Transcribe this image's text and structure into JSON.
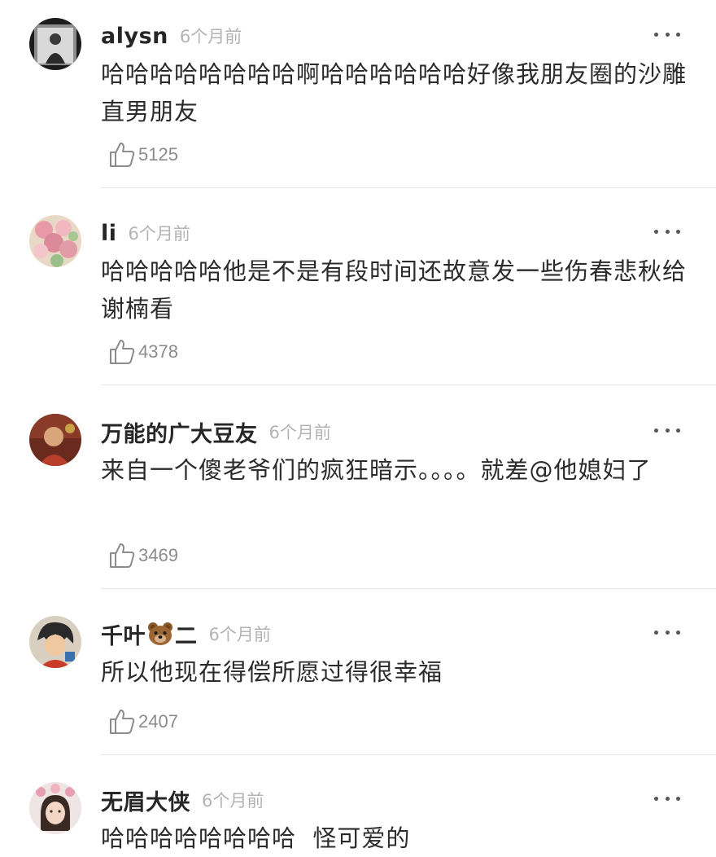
{
  "comments": [
    {
      "username": "alysn",
      "time": "6个月前",
      "text": "哈哈哈哈哈哈哈哈啊哈哈哈哈哈哈好像我朋友圈的沙雕直男朋友",
      "likes": "5125",
      "avatar_icon": "avatar-dark-portrait"
    },
    {
      "username": "li",
      "time": "6个月前",
      "text": "哈哈哈哈哈他是不是有段时间还故意发一些伤春悲秋给谢楠看",
      "likes": "4378",
      "avatar_icon": "avatar-flowers"
    },
    {
      "username": "万能的广大豆友",
      "time": "6个月前",
      "text": "来自一个傻老爷们的疯狂暗示。。。。就差@他媳妇了",
      "likes": "3469",
      "avatar_icon": "avatar-red-portrait"
    },
    {
      "username": "千叶",
      "username_suffix": "二",
      "username_emoji": "bear-face-icon",
      "time": "6个月前",
      "text": "所以他现在得偿所愿过得很幸福",
      "likes": "2407",
      "avatar_icon": "avatar-cartoon"
    },
    {
      "username": "无眉大侠",
      "time": "6个月前",
      "text": "哈哈哈哈哈哈哈哈  怪可爱的",
      "likes": "",
      "avatar_icon": "avatar-girl-flowers"
    }
  ],
  "icons": {
    "more": "more-dots-icon",
    "like": "thumbs-up-outline-icon"
  },
  "colors": {
    "username": "#262626",
    "time": "#b3b3b3",
    "content": "#2b2b2b",
    "like_count": "#8c8c8c",
    "divider": "#e6e6e6"
  }
}
